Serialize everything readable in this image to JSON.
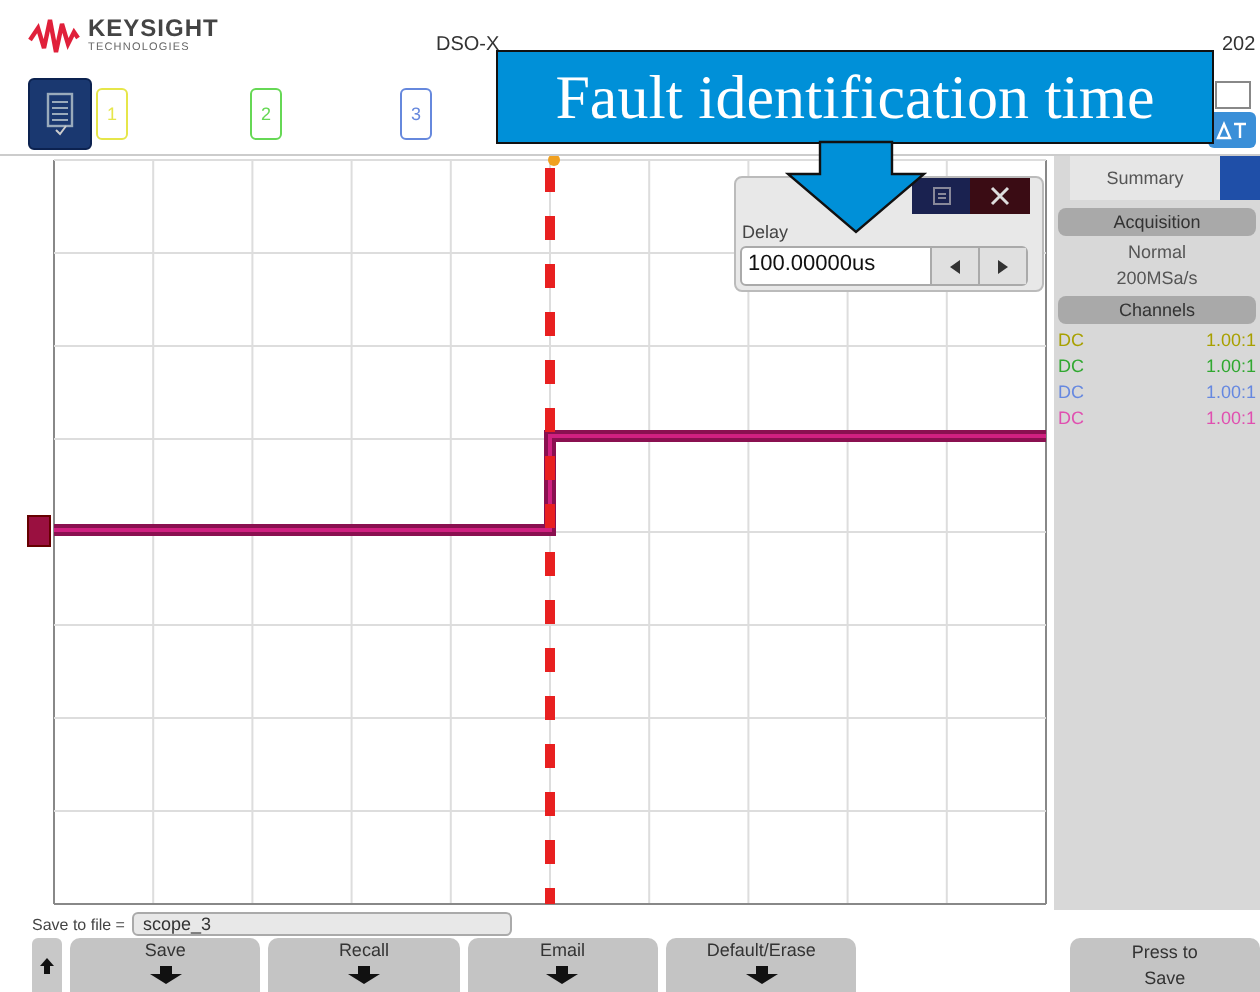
{
  "brand": {
    "name": "KEYSIGHT",
    "tagline": "TECHNOLOGIES"
  },
  "header_info": [
    "DSO-X",
    "202"
  ],
  "channels": [
    {
      "label": "1",
      "color": "#e6e64a"
    },
    {
      "label": "2",
      "color": "#66d855"
    },
    {
      "label": "3",
      "color": "#6688dd"
    }
  ],
  "delay_popup": {
    "label": "Delay",
    "value": "100.00000us"
  },
  "side_panel": {
    "tab": "Summary",
    "acquisition": {
      "heading": "Acquisition",
      "lines": [
        "Normal",
        "200MSa/s"
      ]
    },
    "channels_heading": "Channels",
    "channels": [
      {
        "coupling": "DC",
        "probe": "1.00:1",
        "color": "#a8a000"
      },
      {
        "coupling": "DC",
        "probe": "1.00:1",
        "color": "#30a830"
      },
      {
        "coupling": "DC",
        "probe": "1.00:1",
        "color": "#6688e0"
      },
      {
        "coupling": "DC",
        "probe": "1.00:1",
        "color": "#e050b0"
      }
    ]
  },
  "save_file": {
    "label": "Save to file =",
    "value": "scope_3"
  },
  "softkeys": [
    {
      "label": "Save",
      "kind": "menu"
    },
    {
      "label": "Recall",
      "kind": "menu"
    },
    {
      "label": "Email",
      "kind": "menu"
    },
    {
      "label": "Default/Erase",
      "kind": "menu"
    },
    {
      "kind": "gap"
    },
    {
      "label": "Press to Save",
      "kind": "action"
    }
  ],
  "callout": {
    "text": "Fault identification time"
  }
}
